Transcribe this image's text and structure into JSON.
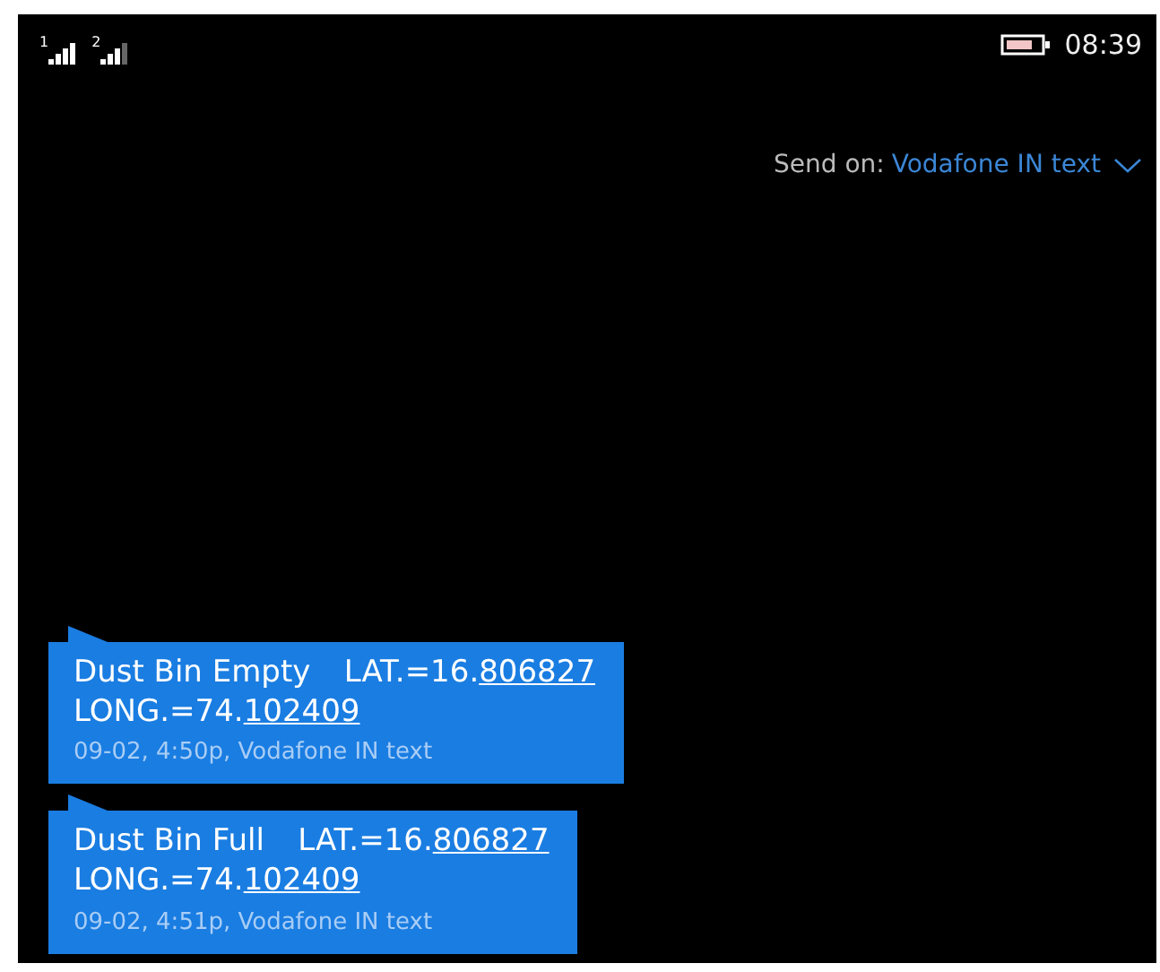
{
  "status_bar": {
    "sims": [
      {
        "label": "1"
      },
      {
        "label": "2"
      }
    ],
    "time": "08:39"
  },
  "send_on": {
    "label": "Send on:",
    "value": "Vodafone IN text"
  },
  "messages": [
    {
      "label": "Dust Bin Empty",
      "lat_prefix": "LAT.=16.",
      "lat_link": "806827",
      "long_prefix": "LONG.=74.",
      "long_link": "102409",
      "meta": "09-02, 4:50p, Vodafone IN text"
    },
    {
      "label": "Dust Bin Full",
      "lat_prefix": "LAT.=16.",
      "lat_link": "806827",
      "long_prefix": "LONG.=74.",
      "long_link": "102409",
      "meta": "09-02, 4:51p, Vodafone IN text"
    }
  ]
}
